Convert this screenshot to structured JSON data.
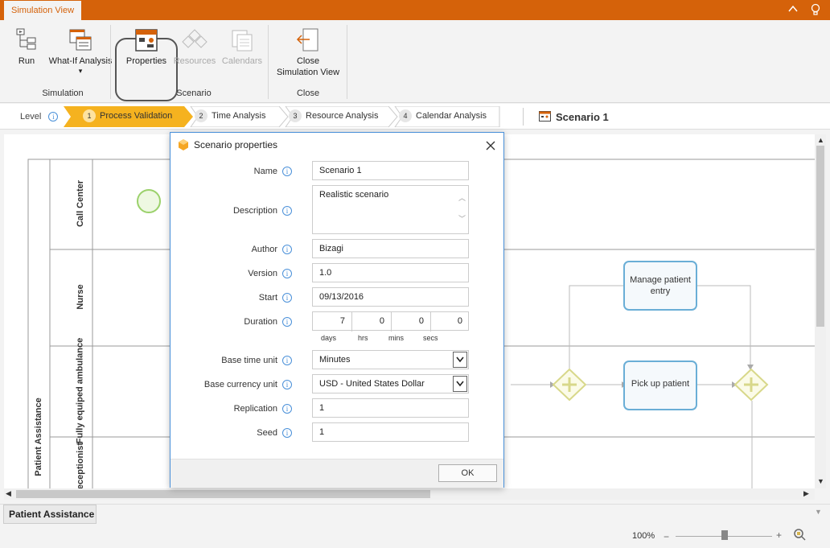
{
  "window": {
    "tab_title": "Simulation View"
  },
  "ribbon": {
    "run_label": "Run",
    "whatif_label": "What-If Analysis",
    "properties_label": "Properties",
    "resources_label": "Resources",
    "calendars_label": "Calendars",
    "close_label_1": "Close",
    "close_label_2": "Simulation View",
    "group_simulation": "Simulation",
    "group_scenario": "Scenario",
    "group_close": "Close"
  },
  "levelbar": {
    "level_label": "Level",
    "steps": [
      {
        "num": "1",
        "label": "Process Validation",
        "active": true
      },
      {
        "num": "2",
        "label": "Time Analysis",
        "active": false
      },
      {
        "num": "3",
        "label": "Resource Analysis",
        "active": false
      },
      {
        "num": "4",
        "label": "Calendar Analysis",
        "active": false
      }
    ],
    "scenario_name": "Scenario 1"
  },
  "diagram": {
    "pool_label": "Patient Assistance",
    "lanes": [
      "Call Center",
      "Nurse",
      "Fully equiped ambulance",
      "Receptionist"
    ],
    "tasks": [
      "Manage patient entry",
      "Pick up patient"
    ]
  },
  "dialog": {
    "title": "Scenario properties",
    "fields": {
      "name_label": "Name",
      "name_value": "Scenario 1",
      "description_label": "Description",
      "description_value": "Realistic scenario",
      "author_label": "Author",
      "author_value": "Bizagi",
      "version_label": "Version",
      "version_value": "1.0",
      "start_label": "Start",
      "start_value": "09/13/2016",
      "duration_label": "Duration",
      "duration_days": "7",
      "duration_hrs": "0",
      "duration_mins": "0",
      "duration_secs": "0",
      "unit_days": "days",
      "unit_hrs": "hrs",
      "unit_mins": "mins",
      "unit_secs": "secs",
      "time_unit_label": "Base time unit",
      "time_unit_value": "Minutes",
      "currency_label": "Base currency unit",
      "currency_value": "USD - United States Dollar",
      "replication_label": "Replication",
      "replication_value": "1",
      "seed_label": "Seed",
      "seed_value": "1"
    },
    "ok_label": "OK"
  },
  "tabs": {
    "active": "Patient Assistance"
  },
  "status": {
    "zoom": "100%"
  },
  "colors": {
    "brand": "#d5620a",
    "active_step": "#f5b21f",
    "task_border": "#6aaed6",
    "gateway": "#d8d88a",
    "start_event": "#9bd16b"
  }
}
